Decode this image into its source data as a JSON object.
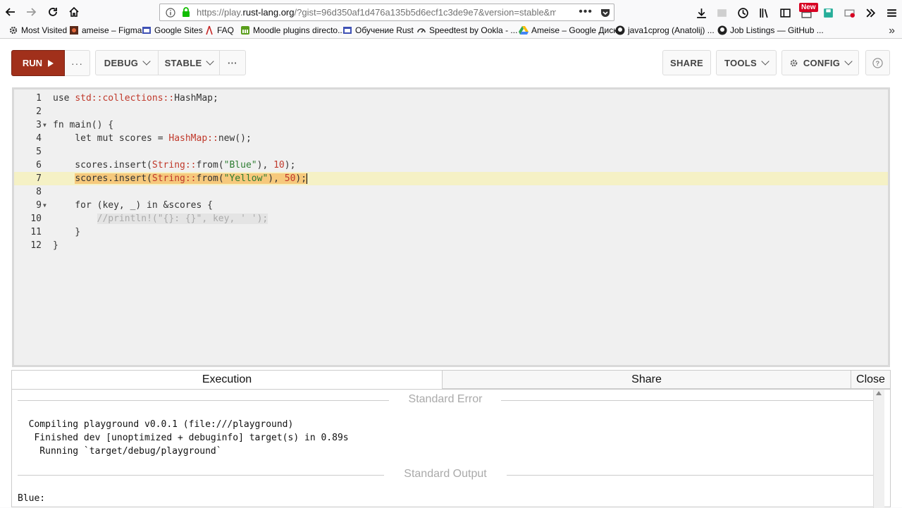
{
  "browser": {
    "url_prefix": "https://play.",
    "url_host": "rust-lang.org",
    "url_rest": "/?gist=96d350af1d476a135b5d6ecf1c3de9e7&version=stable&m",
    "new_badge": "New",
    "bookmarks": [
      {
        "label": "Most Visited",
        "icon": "gear-icon"
      },
      {
        "label": "ameise – Figma",
        "icon": "figma-icon"
      },
      {
        "label": "Google Sites",
        "icon": "sites-icon"
      },
      {
        "label": "FAQ",
        "icon": "faq-icon"
      },
      {
        "label": "Moodle plugins directo...",
        "icon": "moodle-icon"
      },
      {
        "label": "Обучение Rust",
        "icon": "sites-icon"
      },
      {
        "label": "Speedtest by Ookla - ...",
        "icon": "speedtest-icon"
      },
      {
        "label": "Ameise – Google Диск",
        "icon": "drive-icon"
      },
      {
        "label": "java1cprog (Anatolij) ...",
        "icon": "github-icon"
      },
      {
        "label": "Job Listings — GitHub ...",
        "icon": "github-icon"
      }
    ]
  },
  "toolbar": {
    "run_label": "RUN",
    "more_label": "···",
    "debug_label": "DEBUG",
    "stable_label": "STABLE",
    "share_label": "SHARE",
    "tools_label": "TOOLS",
    "config_label": "CONFIG",
    "help_label": "?"
  },
  "editor": {
    "lines": [
      {
        "n": "1",
        "code": "use std::collections::HashMap;"
      },
      {
        "n": "2",
        "code": ""
      },
      {
        "n": "3",
        "code": "fn main() {",
        "fold": true
      },
      {
        "n": "4",
        "code": "    let mut scores = HashMap::new();"
      },
      {
        "n": "5",
        "code": ""
      },
      {
        "n": "6",
        "code": "    scores.insert(String::from(\"Blue\"), 10);"
      },
      {
        "n": "7",
        "code": "    scores.insert(String::from(\"Yellow\"), 50);",
        "highlight": true
      },
      {
        "n": "8",
        "code": ""
      },
      {
        "n": "9",
        "code": "    for (key, _) in &scores {",
        "fold": true
      },
      {
        "n": "10",
        "code": "        //println!(\"{}: {}\", key, ' ');"
      },
      {
        "n": "11",
        "code": "    }"
      },
      {
        "n": "12",
        "code": "}"
      }
    ]
  },
  "output": {
    "tab_execution": "Execution",
    "tab_share": "Share",
    "tab_close": "Close",
    "stderr_label": "Standard Error",
    "stderr_lines": "  Compiling playground v0.0.1 (file:///playground)\n   Finished dev [unoptimized + debuginfo] target(s) in 0.89s\n    Running `target/debug/playground`",
    "stdout_label": "Standard Output",
    "stdout_lines": "Blue:"
  },
  "colors": {
    "run_button": "#a1301b",
    "line_highlight": "#f5f1c5",
    "selection": "#f6c97c"
  }
}
